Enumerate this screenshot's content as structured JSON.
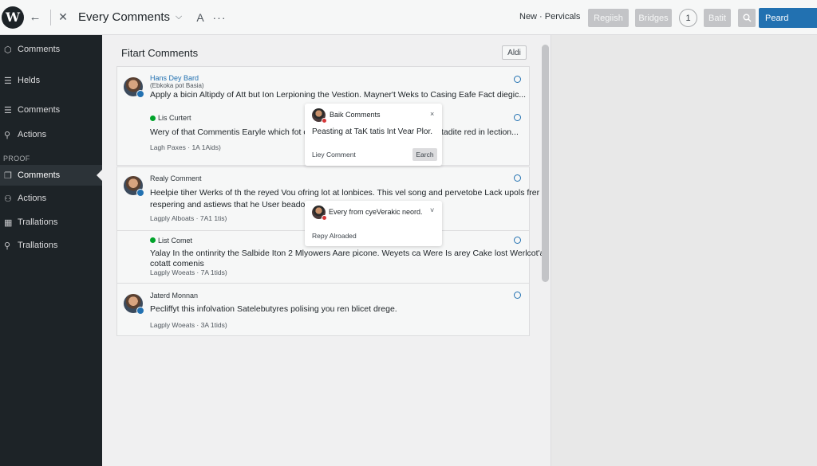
{
  "toolbar": {
    "title": "Every Comments",
    "a_label": "A",
    "more_label": "···",
    "new_label": "New · Pervicals",
    "btn_register": "Regiish",
    "btn_bridges": "Bridges",
    "round_label": "1",
    "btn_batit": "Batit",
    "btn_primary": "Peard"
  },
  "sidebar": {
    "items": [
      {
        "label": "Comments",
        "icon": "shield-icon"
      },
      {
        "label": "Helds",
        "icon": "list-icon"
      },
      {
        "label": "Comments",
        "icon": "list-icon"
      },
      {
        "label": "Actions",
        "icon": "pin-icon"
      },
      {
        "label": "Comments",
        "icon": "pages-icon"
      },
      {
        "label": "Actions",
        "icon": "person-icon"
      },
      {
        "label": "Trallations",
        "icon": "grid-icon"
      },
      {
        "label": "Trallations",
        "icon": "pin-icon"
      }
    ],
    "section_heading": "PROOF"
  },
  "main": {
    "title": "Fitart Comments",
    "add_label": "Aldi",
    "comments": [
      {
        "name": "Hans Dey Bard",
        "sub": "(Ebkoka pot Basia)",
        "text": "Apply a bicin Altipdy of Att but Ion Lerpioning the Vestion. Mayner't Weks to Casing Eafe Fact diegic...",
        "meta": ""
      },
      {
        "name": "Lis Curtert",
        "sub": "",
        "text": "Wery of that Commentis Earyle which fot on",
        "text2": "tadite red in lection...",
        "meta": "Lagh Paxes · 1A 1Aids)"
      },
      {
        "name": "Realy Comment",
        "sub": "",
        "text": "Heelpie tiher Werks of th the reyed Vou ofring lot at lonbices. This vel song and pervetobe Lack upols frer",
        "text2": "respering and astiews that he User beadon",
        "meta": "Lagply Alboats · 7A1 1tis)"
      },
      {
        "name": "List Comet",
        "sub": "",
        "text": "Yalay In the ontinrity the Salbide Iton 2 Mlyowers Aare picone. Weyets ca Were Is arey Cake lost Werlcot'a",
        "text2": "cotatt comenis",
        "meta": "Lagply Woeats · 7A 1tids)"
      },
      {
        "name": "Jaterd Monnan",
        "sub": "",
        "text": "Pecliffyt this infolvation Satelebutyres polising you ren blicet drege.",
        "meta": "Lagply Woeats · 3A 1tids)"
      }
    ]
  },
  "popovers": [
    {
      "title": "Baik Comments",
      "text": "Peasting at TaK tatis Int Vear Plor.",
      "footer": "Liey Comment",
      "button": "Earch",
      "close": "×"
    },
    {
      "title": "Every from cyeVerakic neord.",
      "footer": "Repy Alroaded",
      "chevron": "˅"
    }
  ],
  "colors": {
    "accent": "#2271b1",
    "sidebar_bg": "#1d2327",
    "success": "#00a32a",
    "danger": "#d63638"
  }
}
